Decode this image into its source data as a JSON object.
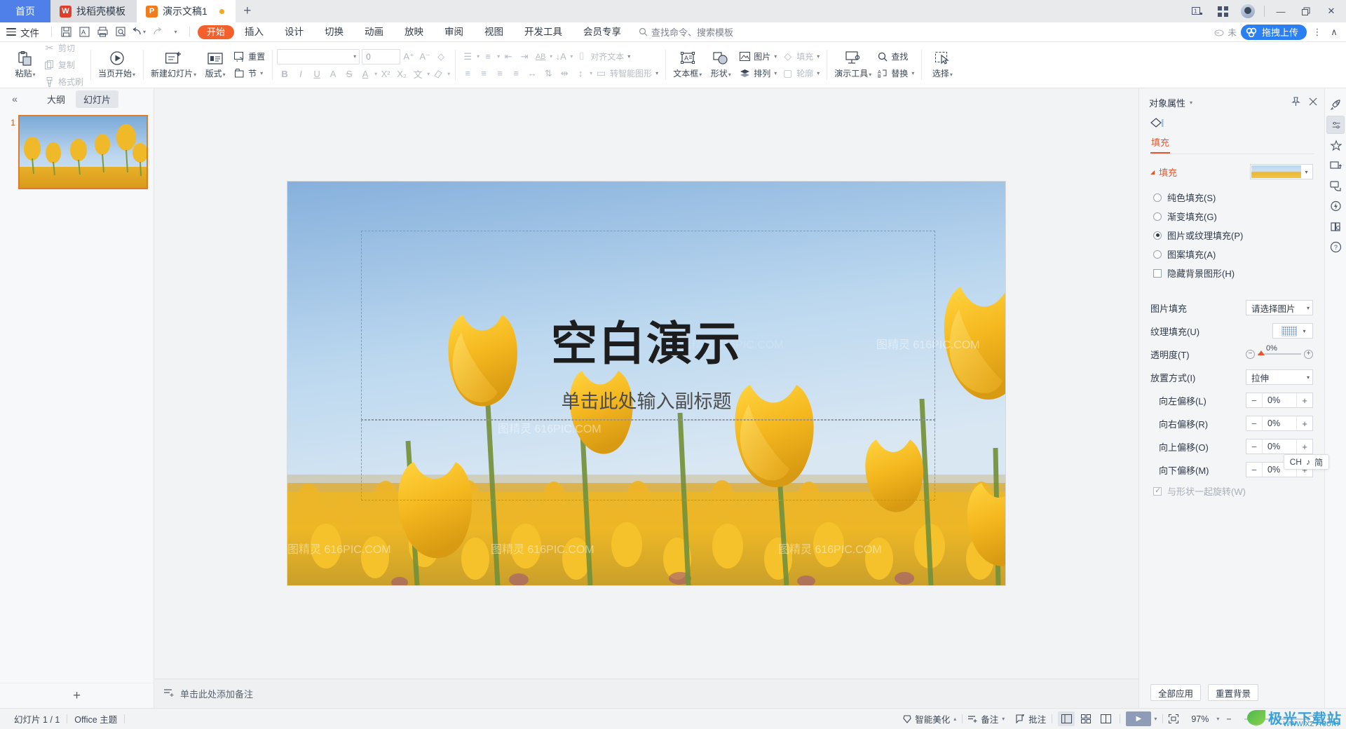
{
  "window": {
    "tabs": [
      {
        "label": "首页",
        "type": "home"
      },
      {
        "label": "找稻壳模板",
        "icon": "docer-icon",
        "type": "docer"
      },
      {
        "label": "演示文稿1",
        "icon": "wpp-icon",
        "type": "doc",
        "active": true
      }
    ],
    "new_tab_label": "+",
    "controls": {
      "layout_label": "1",
      "grid_label": "grid-icon",
      "minimize": "—",
      "restore": "❐",
      "close": "✕"
    }
  },
  "menubar": {
    "file_label": "文件",
    "quick_icons": [
      "save-icon",
      "save-as-icon",
      "print-icon",
      "print-preview-icon",
      "undo-icon",
      "redo-icon",
      "customize-icon"
    ],
    "menus": [
      {
        "label": "开始",
        "active": true
      },
      {
        "label": "插入"
      },
      {
        "label": "设计"
      },
      {
        "label": "切换"
      },
      {
        "label": "动画"
      },
      {
        "label": "放映"
      },
      {
        "label": "审阅"
      },
      {
        "label": "视图"
      },
      {
        "label": "开发工具"
      },
      {
        "label": "会员专享"
      }
    ],
    "search_placeholder": "查找命令、搜索模板",
    "cloud_status": "未",
    "upload_label": "拖拽上传",
    "more_label": "⋮",
    "collapse_label": "∧"
  },
  "ribbon": {
    "groups": [
      {
        "name": "clipboard",
        "big": [
          {
            "label": "粘贴",
            "icon": "paste-icon",
            "caret": true
          }
        ],
        "small": [
          {
            "label": "剪切",
            "icon": "cut-icon",
            "dim": true
          },
          {
            "label": "复制",
            "icon": "copy-icon",
            "dim": true
          },
          {
            "label": "格式刷",
            "icon": "format-painter-icon",
            "dim": true
          }
        ]
      },
      {
        "name": "play",
        "big": [
          {
            "label": "当页开始",
            "icon": "play-circle-icon",
            "caret": true
          }
        ]
      },
      {
        "name": "slides",
        "big": [
          {
            "label": "新建幻灯片",
            "icon": "new-slide-icon",
            "caret": true
          },
          {
            "label": "版式",
            "icon": "layout-icon",
            "caret": true
          }
        ],
        "small": [
          {
            "label": "重置",
            "icon": "reset-icon"
          },
          {
            "label": "节",
            "icon": "section-icon",
            "caret": true
          }
        ]
      },
      {
        "name": "font",
        "font_value": "",
        "font_placeholder": "",
        "size_value": "0",
        "buttons_row2": [
          "B",
          "I",
          "U",
          "A",
          "S",
          "A"
        ],
        "buttons_row1": [
          "A+",
          "A−",
          "clear-format"
        ],
        "extra": [
          "X²",
          "X₂",
          "wen-icon",
          "highlight-icon"
        ]
      },
      {
        "name": "paragraph",
        "row1": [
          "bullets-icon",
          "numbering-icon",
          "decrease-indent-icon",
          "increase-indent-icon",
          "line-space-ab-icon",
          "sort-icon",
          "align-text-icon"
        ],
        "row1_labels": [
          "对齐文本"
        ],
        "row2": [
          "align-left-icon",
          "align-center-icon",
          "align-right-icon",
          "justify-icon",
          "distribute-icon",
          "col-space-icon",
          "row-space-icon",
          "line-height-icon"
        ],
        "row2_labels": [
          "转智能图形"
        ]
      },
      {
        "name": "insert",
        "big": [
          {
            "label": "文本框",
            "icon": "textbox-icon",
            "caret": true
          },
          {
            "label": "形状",
            "icon": "shape-icon",
            "caret": true
          }
        ],
        "small": [
          {
            "label": "图片",
            "icon": "picture-icon",
            "caret": true
          },
          {
            "label": "填充",
            "icon": "fill-icon",
            "caret": true,
            "dim": true
          },
          {
            "label": "排列",
            "icon": "arrange-icon",
            "caret": true
          },
          {
            "label": "轮廓",
            "icon": "outline-icon",
            "caret": true,
            "dim": true
          }
        ]
      },
      {
        "name": "tools",
        "big": [
          {
            "label": "演示工具",
            "icon": "present-tool-icon",
            "caret": true
          }
        ],
        "small": [
          {
            "label": "查找",
            "icon": "search-icon"
          },
          {
            "label": "替换",
            "icon": "replace-icon",
            "caret": true
          }
        ]
      },
      {
        "name": "select",
        "big": [
          {
            "label": "选择",
            "icon": "select-icon",
            "caret": true
          }
        ]
      }
    ]
  },
  "slide_panel": {
    "collapse_label": "«",
    "tabs": [
      {
        "label": "大纲",
        "active": false
      },
      {
        "label": "幻灯片",
        "active": true
      }
    ],
    "thumbnails": [
      {
        "number": "1",
        "selected": true
      }
    ],
    "add_label": "+"
  },
  "slide": {
    "title": "空白演示",
    "subtitle": "单击此处输入副标题",
    "watermark_text": "图精灵 616PIC.COM"
  },
  "notes": {
    "icon": "notes-icon",
    "placeholder": "单击此处添加备注"
  },
  "properties": {
    "panel_title": "对象属性",
    "panel_caret": "▾",
    "pin_icon": "pin-icon",
    "close_icon": "close-icon",
    "tab_icon": "fill-shape-icon",
    "tab_label": "填充",
    "section_title": "填充",
    "section_caret": "◢",
    "preview_caret": "▾",
    "fill_options": [
      {
        "label": "纯色填充(S)",
        "selected": false
      },
      {
        "label": "渐变填充(G)",
        "selected": false
      },
      {
        "label": "图片或纹理填充(P)",
        "selected": true
      },
      {
        "label": "图案填充(A)",
        "selected": false
      }
    ],
    "hide_bg": {
      "label": "隐藏背景图形(H)",
      "checked": false
    },
    "picture_fill": {
      "label": "图片填充",
      "value": "请选择图片"
    },
    "texture_fill": {
      "label": "纹理填充(U)",
      "value": "texture-swatch"
    },
    "transparency": {
      "label": "透明度(T)",
      "value": "0%"
    },
    "placement": {
      "label": "放置方式(I)",
      "value": "拉伸"
    },
    "offsets": [
      {
        "label": "向左偏移(L)",
        "value": "0%"
      },
      {
        "label": "向右偏移(R)",
        "value": "0%"
      },
      {
        "label": "向上偏移(O)",
        "value": "0%"
      },
      {
        "label": "向下偏移(M)",
        "value": "0%"
      }
    ],
    "rotate_with_shape": {
      "label": "与形状一起旋转(W)",
      "checked": true
    },
    "apply_all_label": "全部应用",
    "reset_bg_label": "重置背景"
  },
  "rail": {
    "icons": [
      {
        "name": "rocket-icon",
        "selected": false
      },
      {
        "name": "sliders-icon",
        "selected": true
      },
      {
        "name": "star-sparkle-icon",
        "selected": false
      },
      {
        "name": "transition-icon",
        "selected": false
      },
      {
        "name": "animation-hand-icon",
        "selected": false
      },
      {
        "name": "lightning-icon",
        "selected": false
      },
      {
        "name": "book-search-icon",
        "selected": false
      },
      {
        "name": "help-icon",
        "selected": false
      }
    ]
  },
  "ime": {
    "lang": "CH",
    "music": "♪",
    "mode": "简"
  },
  "status": {
    "slide_count": "幻灯片 1 / 1",
    "theme": "Office 主题",
    "beautify": "智能美化",
    "beautify_caret": "▴",
    "notes_label": "备注",
    "comment_label": "批注",
    "views": [
      "normal-view-icon",
      "sorter-view-icon",
      "reading-view-icon"
    ],
    "play_label": "▶",
    "play_caret": "▾",
    "fit_icon": "fit-icon",
    "zoom": "97%",
    "zoom_caret": "▾",
    "zoom_minus": "−",
    "zoom_plus": "+"
  },
  "watermark": {
    "brand": "极光下载站",
    "url": "www.xz7.com"
  }
}
